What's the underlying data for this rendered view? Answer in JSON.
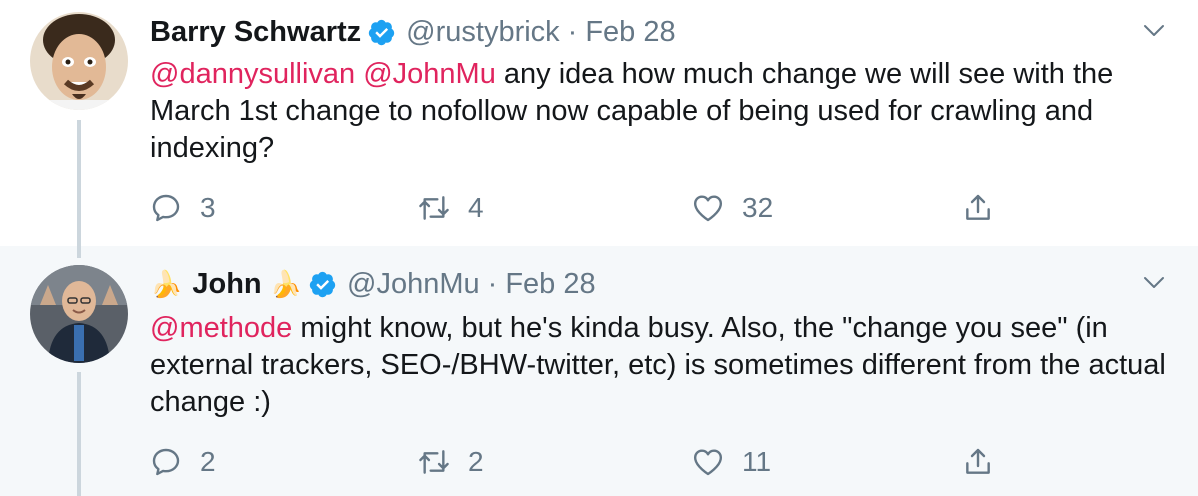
{
  "tweets": [
    {
      "name": "Barry Schwartz",
      "handle": "@rustybrick",
      "separator": "·",
      "date": "Feb 28",
      "mentions": [
        "@dannysullivan",
        "@JohnMu"
      ],
      "text": "any idea how much change we will see with the March 1st change to nofollow now capable of being used for crawling and indexing?",
      "replies": "3",
      "retweets": "4",
      "likes": "32"
    },
    {
      "name": "John",
      "name_emoji": "🍌",
      "handle": "@JohnMu",
      "separator": "·",
      "date": "Feb 28",
      "mentions": [
        "@methode"
      ],
      "text": "might know, but he's kinda busy. Also, the \"change you see\" (in external trackers, SEO-/BHW-twitter, etc) is sometimes different from the actual change :)",
      "replies": "2",
      "retweets": "2",
      "likes": "11"
    }
  ],
  "icons": {
    "verified": "verified-badge-icon",
    "reply": "reply-icon",
    "retweet": "retweet-icon",
    "like": "heart-icon",
    "share": "share-icon",
    "menu": "chevron-down-icon"
  },
  "colors": {
    "mention": "#e0245e",
    "verified": "#1da1f2",
    "muted": "#657786",
    "thread_line": "#ccd6dd",
    "reply_bg": "#f5f8fa"
  }
}
